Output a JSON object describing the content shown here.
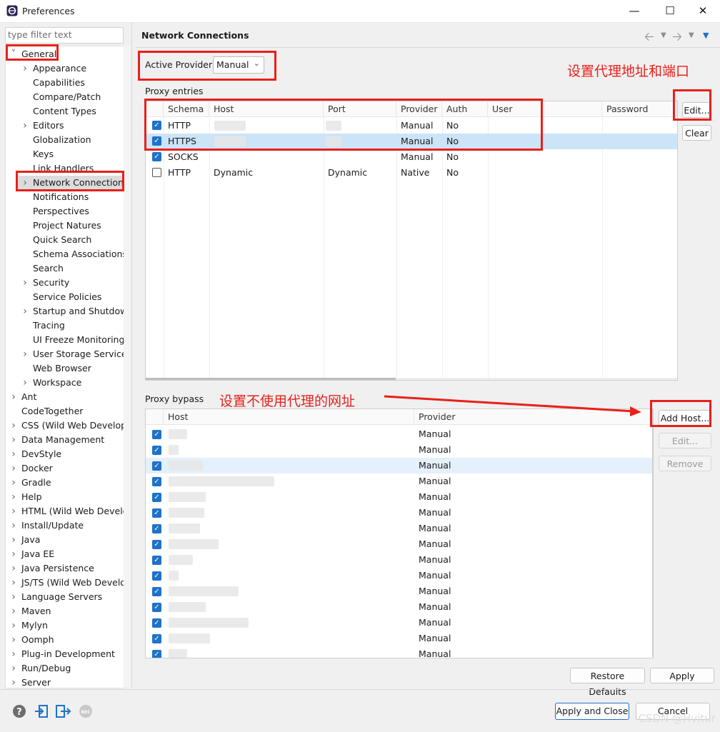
{
  "window": {
    "title": "Preferences",
    "controls": [
      "minimize-icon",
      "maximize-icon",
      "close-icon"
    ]
  },
  "filter": {
    "placeholder": "type filter text"
  },
  "tree": {
    "items": [
      {
        "label": "General",
        "expanded": true
      },
      {
        "label": "Appearance",
        "expandable": true
      },
      {
        "label": "Capabilities"
      },
      {
        "label": "Compare/Patch"
      },
      {
        "label": "Content Types"
      },
      {
        "label": "Editors",
        "expandable": true
      },
      {
        "label": "Globalization"
      },
      {
        "label": "Keys"
      },
      {
        "label": "Link Handlers"
      },
      {
        "label": "Network Connections",
        "expandable": true,
        "selected": true
      },
      {
        "label": "Notifications"
      },
      {
        "label": "Perspectives"
      },
      {
        "label": "Project Natures"
      },
      {
        "label": "Quick Search"
      },
      {
        "label": "Schema Associations"
      },
      {
        "label": "Search"
      },
      {
        "label": "Security",
        "expandable": true
      },
      {
        "label": "Service Policies"
      },
      {
        "label": "Startup and Shutdown",
        "expandable": true
      },
      {
        "label": "Tracing"
      },
      {
        "label": "UI Freeze Monitoring"
      },
      {
        "label": "User Storage Service",
        "expandable": true
      },
      {
        "label": "Web Browser"
      },
      {
        "label": "Workspace",
        "expandable": true
      },
      {
        "label": "Ant",
        "expandable": true
      },
      {
        "label": "CodeTogether"
      },
      {
        "label": "CSS (Wild Web Developer)",
        "expandable": true
      },
      {
        "label": "Data Management",
        "expandable": true
      },
      {
        "label": "DevStyle",
        "expandable": true
      },
      {
        "label": "Docker",
        "expandable": true
      },
      {
        "label": "Gradle",
        "expandable": true
      },
      {
        "label": "Help",
        "expandable": true
      },
      {
        "label": "HTML (Wild Web Developer)",
        "expandable": true
      },
      {
        "label": "Install/Update",
        "expandable": true
      },
      {
        "label": "Java",
        "expandable": true
      },
      {
        "label": "Java EE",
        "expandable": true
      },
      {
        "label": "Java Persistence",
        "expandable": true
      },
      {
        "label": "JS/TS (Wild Web Developer)",
        "expandable": true
      },
      {
        "label": "Language Servers",
        "expandable": true
      },
      {
        "label": "Maven",
        "expandable": true
      },
      {
        "label": "Mylyn",
        "expandable": true
      },
      {
        "label": "Oomph",
        "expandable": true
      },
      {
        "label": "Plug-in Development",
        "expandable": true
      },
      {
        "label": "Run/Debug",
        "expandable": true
      },
      {
        "label": "Server",
        "expandable": true
      }
    ]
  },
  "page": {
    "title": "Network Connections",
    "active_provider_label": "Active Provider:",
    "active_provider_value": "Manual",
    "proxy_entries_label": "Proxy entries",
    "entries_columns": [
      "Schema",
      "Host",
      "Port",
      "Provider",
      "Auth",
      "User",
      "Password"
    ],
    "entries": [
      {
        "checked": true,
        "schema": "HTTP",
        "host": "",
        "port": "",
        "provider": "Manual",
        "auth": "No",
        "selected": false,
        "redacted": true
      },
      {
        "checked": true,
        "schema": "HTTPS",
        "host": "",
        "port": "",
        "provider": "Manual",
        "auth": "No",
        "selected": true,
        "redacted": true
      },
      {
        "checked": true,
        "schema": "SOCKS",
        "host": "",
        "port": "",
        "provider": "Manual",
        "auth": "No",
        "selected": false,
        "redacted": false
      },
      {
        "checked": false,
        "schema": "HTTP",
        "host": "Dynamic",
        "port": "Dynamic",
        "provider": "Native",
        "auth": "No",
        "selected": false,
        "redacted": false
      }
    ],
    "entries_buttons": {
      "edit": "Edit...",
      "clear": "Clear"
    },
    "proxy_bypass_label": "Proxy bypass",
    "bypass_columns": [
      "Host",
      "Provider"
    ],
    "bypass_rows": [
      {
        "provider": "Manual"
      },
      {
        "provider": "Manual"
      },
      {
        "provider": "Manual",
        "selected": true
      },
      {
        "provider": "Manual"
      },
      {
        "provider": "Manual"
      },
      {
        "provider": "Manual"
      },
      {
        "provider": "Manual"
      },
      {
        "provider": "Manual"
      },
      {
        "provider": "Manual"
      },
      {
        "provider": "Manual"
      },
      {
        "provider": "Manual"
      },
      {
        "provider": "Manual"
      },
      {
        "provider": "Manual"
      },
      {
        "provider": "Manual"
      },
      {
        "provider": "Manual"
      }
    ],
    "bypass_buttons": {
      "add": "Add Host...",
      "edit": "Edit...",
      "remove": "Remove"
    },
    "restore_defaults": "Restore Defaults",
    "apply": "Apply"
  },
  "footer": {
    "apply_close": "Apply and Close",
    "cancel": "Cancel"
  },
  "annotations": {
    "proxy_note": "设置代理地址和端口",
    "bypass_note": "设置不使用代理的网址",
    "color": "#e8201a"
  },
  "watermark": "CSDN @Hvitur"
}
